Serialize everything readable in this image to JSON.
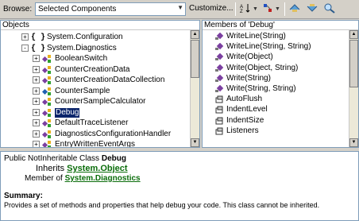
{
  "toolbar": {
    "browse_label": "Browse:",
    "browse_value": "Selected Components",
    "customize_label": "Customize...",
    "sort_icon": "sort-az-icon",
    "group_icon": "group-by-icon",
    "back_icon": "back-icon",
    "forward_icon": "forward-icon",
    "find_icon": "find-symbol-icon"
  },
  "objects_pane": {
    "header": "Objects",
    "rows": [
      {
        "label": "System.Configuration",
        "kind": "namespace",
        "expander": "+"
      },
      {
        "label": "System.Diagnostics",
        "kind": "namespace",
        "expander": "-"
      },
      {
        "label": "BooleanSwitch",
        "kind": "class",
        "expander": "+"
      },
      {
        "label": "CounterCreationData",
        "kind": "class",
        "expander": "+"
      },
      {
        "label": "CounterCreationDataCollection",
        "kind": "class",
        "expander": "+"
      },
      {
        "label": "CounterSample",
        "kind": "struct",
        "expander": "+"
      },
      {
        "label": "CounterSampleCalculator",
        "kind": "class",
        "expander": "+"
      },
      {
        "label": "Debug",
        "kind": "class",
        "expander": "+",
        "selected": true
      },
      {
        "label": "DefaultTraceListener",
        "kind": "class",
        "expander": "+"
      },
      {
        "label": "DiagnosticsConfigurationHandler",
        "kind": "class",
        "expander": "+"
      },
      {
        "label": "EntryWrittenEventArgs",
        "kind": "class",
        "expander": "+"
      }
    ]
  },
  "members_pane": {
    "header": "Members of 'Debug'",
    "rows": [
      {
        "label": "WriteLine(String)",
        "kind": "method"
      },
      {
        "label": "WriteLine(String, String)",
        "kind": "method"
      },
      {
        "label": "Write(Object)",
        "kind": "method"
      },
      {
        "label": "Write(Object, String)",
        "kind": "method"
      },
      {
        "label": "Write(String)",
        "kind": "method"
      },
      {
        "label": "Write(String, String)",
        "kind": "method"
      },
      {
        "label": "AutoFlush",
        "kind": "property"
      },
      {
        "label": "IndentLevel",
        "kind": "property"
      },
      {
        "label": "IndentSize",
        "kind": "property"
      },
      {
        "label": "Listeners",
        "kind": "property"
      }
    ]
  },
  "description": {
    "signature_prefix": "Public NotInheritable Class ",
    "signature_name": "Debug",
    "inherits_label": "Inherits ",
    "inherits_link": "System.Object",
    "member_of_label": "Member of ",
    "member_of_link": "System.Diagnostics",
    "summary_label": "Summary:",
    "summary_text": "Provides a set of methods and properties that help debug your code. This class cannot be inherited."
  },
  "colors": {
    "namespace_brace": "#000000",
    "class_purple": "#7b3fa0",
    "selection": "#0a246a",
    "link_green": "#0b6d0b"
  }
}
